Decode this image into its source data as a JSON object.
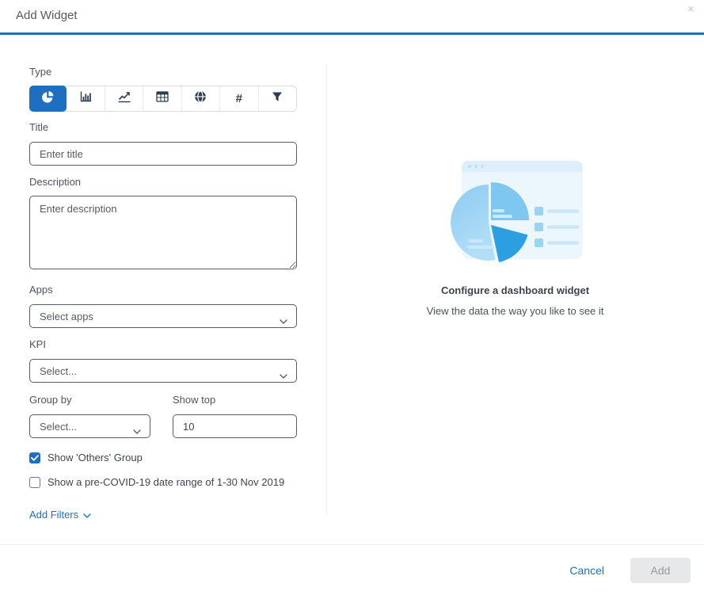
{
  "modal": {
    "title": "Add Widget",
    "close_glyph": "✕"
  },
  "form": {
    "type_label": "Type",
    "type_options": [
      "pie-chart",
      "bar-chart",
      "line-chart",
      "table",
      "globe",
      "number",
      "filter"
    ],
    "selected_type": "pie-chart",
    "hash_glyph": "#",
    "title_label": "Title",
    "title_placeholder": "Enter title",
    "description_label": "Description",
    "description_placeholder": "Enter description",
    "apps_label": "Apps",
    "apps_placeholder": "Select apps",
    "kpi_label": "KPI",
    "kpi_placeholder": "Select...",
    "group_by_label": "Group by",
    "group_by_placeholder": "Select...",
    "show_top_label": "Show top",
    "show_top_value": "10",
    "checkbox_others": {
      "label": "Show 'Others' Group",
      "checked": true
    },
    "checkbox_precovid": {
      "label": "Show a pre-COVID-19 date range of 1-30 Nov 2019",
      "checked": false
    },
    "add_filters_label": "Add Filters"
  },
  "preview": {
    "heading": "Configure a dashboard widget",
    "subheading": "View the data the way you like to see it"
  },
  "footer": {
    "cancel_label": "Cancel",
    "add_label": "Add"
  },
  "colors": {
    "accent": "#1e6fc0",
    "icon_dark": "#2e3c4e",
    "input_border": "#565d66",
    "illustration_card": "#ecf6fd",
    "illustration_card_header": "#ddeffa",
    "illustration_pie_light": "#a5d8f5",
    "illustration_pie_mid": "#7ec7f0",
    "illustration_pie_dark": "#2c9fe0"
  }
}
